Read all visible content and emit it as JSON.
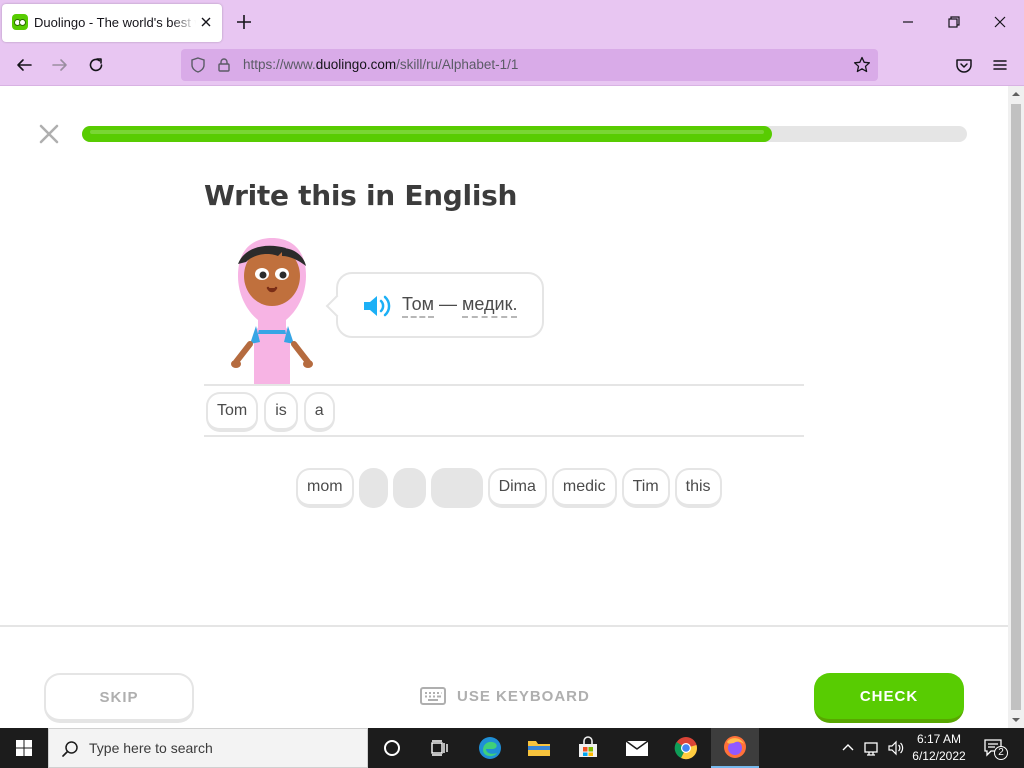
{
  "browser": {
    "tab": {
      "title": "Duolingo - The world's best way to learn a language"
    },
    "url": {
      "prefix": "https://www.",
      "domain": "duolingo.com",
      "path": "/skill/ru/Alphabet-1/1"
    }
  },
  "lesson": {
    "progress_percent": 78,
    "heading": "Write this in English",
    "prompt": {
      "word1": "Том",
      "dash": "—",
      "word2": "медик."
    },
    "answer_words": [
      "Tom",
      "is",
      "a"
    ],
    "word_bank": {
      "w0": "mom",
      "w4": "Dima",
      "w5": "medic",
      "w6": "Tim",
      "w7": "this"
    }
  },
  "footer": {
    "skip_label": "SKIP",
    "keyboard_label": "USE KEYBOARD",
    "check_label": "CHECK"
  },
  "taskbar": {
    "search_placeholder": "Type here to search",
    "time": "6:17 AM",
    "date": "6/12/2022",
    "notification_count": "2"
  },
  "colors": {
    "brand_green": "#58cc02",
    "browser_chrome": "#e8c6f2",
    "text_dark": "#3c3c3c",
    "border": "#e5e5e5"
  }
}
